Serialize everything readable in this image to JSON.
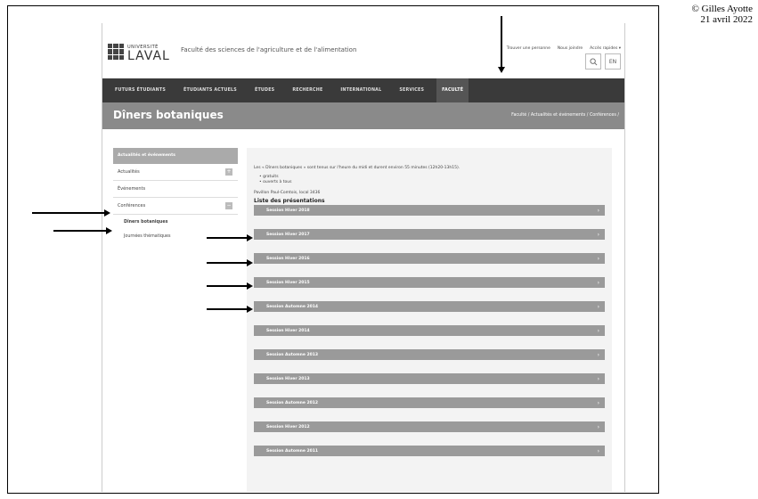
{
  "credit": {
    "author": "© Gilles Ayotte",
    "date": "21 avril  2022"
  },
  "header": {
    "logo_small": "UNIVERSITÉ",
    "logo_big": "LAVAL",
    "faculty": "Faculté des sciences de l'agriculture et de l'alimentation",
    "top_links": [
      "Trouver une personne",
      "Nous joindre",
      "Accès rapides ▾"
    ],
    "search_icon": "search-icon",
    "lang_button": "EN"
  },
  "nav": {
    "items": [
      "FUTURS ÉTUDIANTS",
      "ÉTUDIANTS ACTUELS",
      "ÉTUDES",
      "RECHERCHE",
      "INTERNATIONAL",
      "SERVICES",
      "FACULTÉ"
    ],
    "active_index": 6
  },
  "banner": {
    "title": "Dîners botaniques",
    "breadcrumb": "Faculté  /  Actualités et événements  /  Conférences  /"
  },
  "sidebar": {
    "heading": "Actualités et événements",
    "items": [
      {
        "label": "Actualités",
        "plus": "+"
      },
      {
        "label": "Événements",
        "plus": ""
      },
      {
        "label": "Conférences",
        "plus": "−"
      }
    ],
    "subitems": [
      "Dîners botaniques",
      "Journées thématiques"
    ]
  },
  "main": {
    "intro": "Les « Dîners botaniques » sont tenus sur l'heure du midi et durent environ 55 minutes (12h20-13h15).",
    "bullets": [
      "gratuits",
      "ouverts à tous"
    ],
    "location": "Pavillon Paul-Comtois, local 3436",
    "list_title": "Liste des présentations",
    "sessions": [
      "Session Hiver 2018",
      "Session Hiver 2017",
      "Session Hiver 2016",
      "Session Hiver 2015",
      "Session Automne 2014",
      "Session Hiver 2014",
      "Session Automne 2013",
      "Session Hiver 2013",
      "Session Automne 2012",
      "Session Hiver 2012",
      "Session Automne 2011"
    ],
    "chevron": "›"
  }
}
